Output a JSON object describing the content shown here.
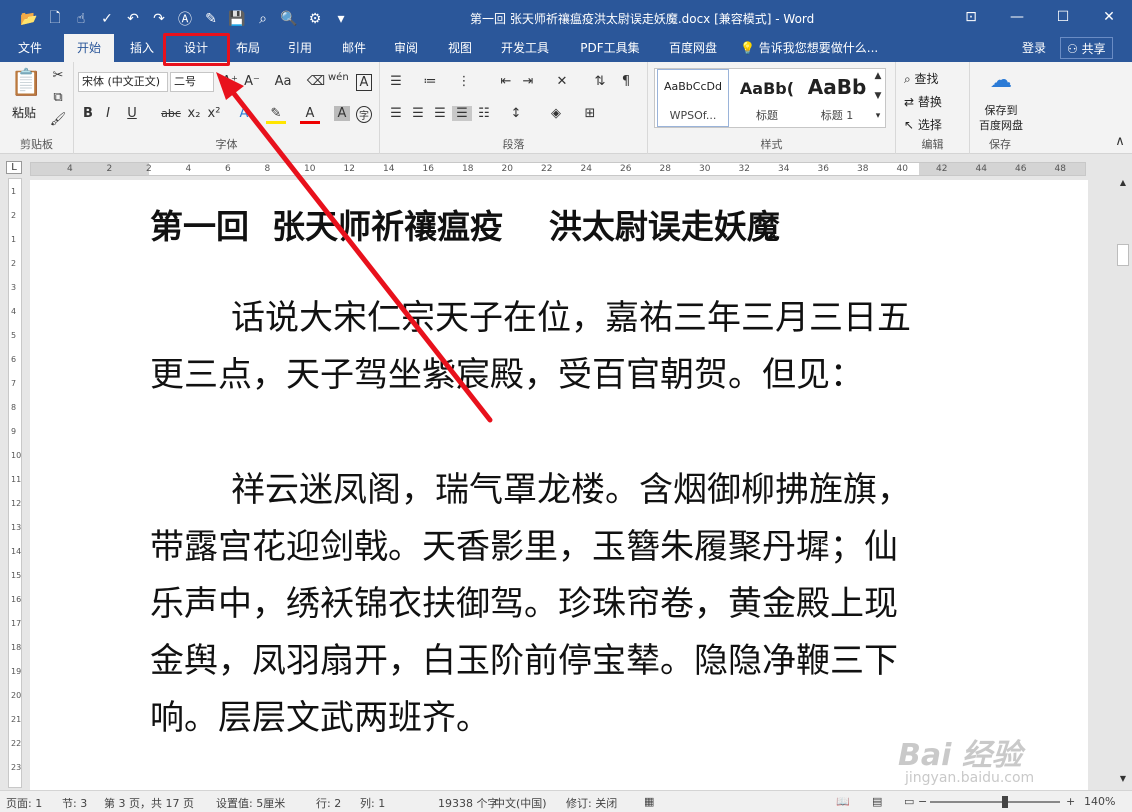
{
  "window": {
    "title": "第一回 张天师祈禳瘟疫洪太尉误走妖魔.docx [兼容模式] - Word",
    "minimize": "—",
    "maximize": "☐",
    "close": "✕",
    "ribbon_display": "⊡"
  },
  "qat": {
    "icons": [
      "folder-open-icon",
      "new-doc-icon",
      "touch-mode-icon",
      "spelling-icon",
      "undo-icon",
      "redo-icon",
      "format-icon",
      "edit-icon",
      "save-icon",
      "search-icon",
      "print-preview-icon",
      "web-icon"
    ]
  },
  "tabs": {
    "file": "文件",
    "home": "开始",
    "insert": "插入",
    "design": "设计",
    "layout": "布局",
    "references": "引用",
    "mailings": "邮件",
    "review": "审阅",
    "view": "视图",
    "developer": "开发工具",
    "pdf": "PDF工具集",
    "baidu": "百度网盘",
    "tellme": "告诉我您想要做什么...",
    "login": "登录",
    "share": "共享"
  },
  "ribbon": {
    "clipboard": {
      "paste": "粘贴",
      "label": "剪贴板"
    },
    "font": {
      "name": "宋体 (中文正文)",
      "size": "二号",
      "label": "字体",
      "aa": "Aa",
      "bold": "B",
      "italic": "I",
      "underline": "U",
      "strike": "abc",
      "sub": "x₂",
      "sup": "x²",
      "wen": "wén",
      "a_box": "A",
      "a_circle": "字"
    },
    "paragraph": {
      "label": "段落"
    },
    "styles": {
      "label": "样式",
      "items": [
        {
          "preview": "AaBbCcDd",
          "name": "WPSOf..."
        },
        {
          "preview": "AaBb(",
          "name": "标题"
        },
        {
          "preview": "AaBb",
          "name": "标题 1"
        }
      ]
    },
    "editing": {
      "find": "查找",
      "replace": "替换",
      "select": "选择",
      "label": "编辑"
    },
    "save": {
      "line1": "保存到",
      "line2": "百度网盘",
      "label": "保存"
    }
  },
  "ruler": {
    "h_ticks": [
      "4",
      "2",
      "2",
      "4",
      "6",
      "8",
      "10",
      "12",
      "14",
      "16",
      "18",
      "20",
      "22",
      "24",
      "26",
      "28",
      "30",
      "32",
      "34",
      "36",
      "38",
      "40",
      "42",
      "44",
      "46",
      "48"
    ],
    "v_ticks": [
      "1",
      "2",
      "1",
      "2",
      "3",
      "4",
      "5",
      "6",
      "7",
      "8",
      "9",
      "10",
      "11",
      "12",
      "13",
      "14",
      "15",
      "16",
      "17",
      "18",
      "19",
      "20",
      "21",
      "22",
      "23"
    ]
  },
  "document": {
    "title": "第一回  张天师祈禳瘟疫    洪太尉误走妖魔",
    "para1": "话说大宋仁宗天子在位，嘉祐三年三月三日五更三点，天子驾坐紫宸殿，受百官朝贺。但见：",
    "para2": "祥云迷凤阁，瑞气罩龙楼。含烟御柳拂旌旗，带露宫花迎剑戟。天香影里，玉簪朱履聚丹墀；仙乐声中，绣袄锦衣扶御驾。珍珠帘卷，黄金殿上现金舆，凤羽扇开，白玉阶前停宝辇。隐隐净鞭三下响。层层文武两班齐。"
  },
  "status": {
    "page": "页面: 1",
    "section": "节: 3",
    "pages": "第 3 页，共 17 页",
    "position": "设置值: 5厘米",
    "row": "行: 2",
    "col": "列: 1",
    "words": "19338 个字",
    "lang": "中文(中国)",
    "revision": "修订: 关闭",
    "zoom": "140%"
  },
  "watermark": {
    "text": "Bai 经验",
    "url": "jingyan.baidu.com"
  },
  "colors": {
    "accent": "#2b579a",
    "highlight": "#e8111c"
  }
}
